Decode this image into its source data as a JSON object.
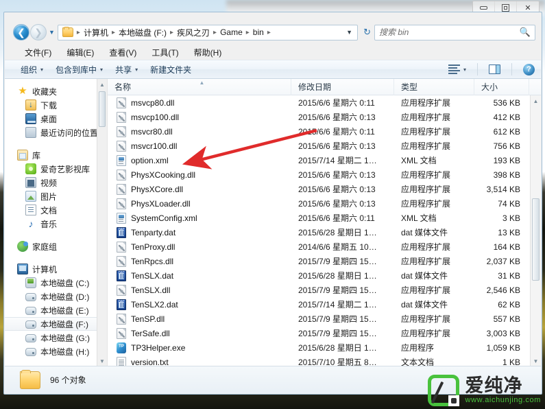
{
  "window": {
    "controls": {
      "minimize": "—",
      "restore": "❐",
      "close": "✕"
    }
  },
  "addressbar": {
    "back_label": "◀",
    "forward_label": "▶",
    "history_caret": "▼",
    "folder_icon": "folder-icon",
    "crumbs": [
      "计算机",
      "本地磁盘 (F:)",
      "疾风之刃",
      "Game",
      "bin"
    ],
    "separator": "▸",
    "dropdown_caret": "▼",
    "refresh_label": "↻"
  },
  "search": {
    "placeholder": "搜索 bin",
    "value": "",
    "icon": "search-icon"
  },
  "menubar": {
    "items": [
      "文件(F)",
      "编辑(E)",
      "查看(V)",
      "工具(T)",
      "帮助(H)"
    ]
  },
  "toolbar": {
    "organize": "组织",
    "include_in_library": "包含到库中",
    "share": "共享",
    "new_folder": "新建文件夹",
    "caret": "▾",
    "help_glyph": "?"
  },
  "navpane": {
    "groups": [
      {
        "header": {
          "label": "收藏夹",
          "icon": "star-icon"
        },
        "items": [
          {
            "label": "下载",
            "icon": "downloads-icon"
          },
          {
            "label": "桌面",
            "icon": "desktop-icon"
          },
          {
            "label": "最近访问的位置",
            "icon": "recent-places-icon"
          }
        ]
      },
      {
        "header": {
          "label": "库",
          "icon": "library-icon"
        },
        "items": [
          {
            "label": "爱奇艺影视库",
            "icon": "iqiyi-icon"
          },
          {
            "label": "视频",
            "icon": "videos-icon"
          },
          {
            "label": "图片",
            "icon": "pictures-icon"
          },
          {
            "label": "文档",
            "icon": "documents-icon"
          },
          {
            "label": "音乐",
            "icon": "music-icon"
          }
        ]
      },
      {
        "header": {
          "label": "家庭组",
          "icon": "homegroup-icon"
        },
        "items": []
      },
      {
        "header": {
          "label": "计算机",
          "icon": "computer-icon"
        },
        "items": [
          {
            "label": "本地磁盘 (C:)",
            "icon": "system-drive-icon",
            "selected": false
          },
          {
            "label": "本地磁盘 (D:)",
            "icon": "drive-icon",
            "selected": false
          },
          {
            "label": "本地磁盘 (E:)",
            "icon": "drive-icon",
            "selected": false
          },
          {
            "label": "本地磁盘 (F:)",
            "icon": "drive-icon",
            "selected": true
          },
          {
            "label": "本地磁盘 (G:)",
            "icon": "drive-icon",
            "selected": false
          },
          {
            "label": "本地磁盘 (H:)",
            "icon": "drive-icon",
            "selected": false
          }
        ]
      }
    ]
  },
  "filelist": {
    "columns": [
      "名称",
      "修改日期",
      "类型",
      "大小"
    ],
    "sort_indicator": "▲",
    "rows": [
      {
        "name": "msvcp80.dll",
        "icon": "dll-file-icon",
        "date": "2015/6/6 星期六 0:11",
        "type": "应用程序扩展",
        "size": "536 KB"
      },
      {
        "name": "msvcp100.dll",
        "icon": "dll-file-icon",
        "date": "2015/6/6 星期六 0:13",
        "type": "应用程序扩展",
        "size": "412 KB"
      },
      {
        "name": "msvcr80.dll",
        "icon": "dll-file-icon",
        "date": "2015/6/6 星期六 0:11",
        "type": "应用程序扩展",
        "size": "612 KB"
      },
      {
        "name": "msvcr100.dll",
        "icon": "dll-file-icon",
        "date": "2015/6/6 星期六 0:13",
        "type": "应用程序扩展",
        "size": "756 KB"
      },
      {
        "name": "option.xml",
        "icon": "xml-file-icon",
        "date": "2015/7/14 星期二 1…",
        "type": "XML 文档",
        "size": "193 KB"
      },
      {
        "name": "PhysXCooking.dll",
        "icon": "dll-file-icon",
        "date": "2015/6/6 星期六 0:13",
        "type": "应用程序扩展",
        "size": "398 KB"
      },
      {
        "name": "PhysXCore.dll",
        "icon": "dll-file-icon",
        "date": "2015/6/6 星期六 0:13",
        "type": "应用程序扩展",
        "size": "3,514 KB"
      },
      {
        "name": "PhysXLoader.dll",
        "icon": "dll-file-icon",
        "date": "2015/6/6 星期六 0:13",
        "type": "应用程序扩展",
        "size": "74 KB"
      },
      {
        "name": "SystemConfig.xml",
        "icon": "xml-file-icon",
        "date": "2015/6/6 星期六 0:11",
        "type": "XML 文档",
        "size": "3 KB"
      },
      {
        "name": "Tenparty.dat",
        "icon": "dat-file-icon",
        "date": "2015/6/28 星期日 1…",
        "type": "dat 媒体文件",
        "size": "13 KB"
      },
      {
        "name": "TenProxy.dll",
        "icon": "dll-file-icon",
        "date": "2014/6/6 星期五 10…",
        "type": "应用程序扩展",
        "size": "164 KB"
      },
      {
        "name": "TenRpcs.dll",
        "icon": "dll-file-icon",
        "date": "2015/7/9 星期四 15…",
        "type": "应用程序扩展",
        "size": "2,037 KB"
      },
      {
        "name": "TenSLX.dat",
        "icon": "dat-file-icon",
        "date": "2015/6/28 星期日 1…",
        "type": "dat 媒体文件",
        "size": "31 KB"
      },
      {
        "name": "TenSLX.dll",
        "icon": "dll-file-icon",
        "date": "2015/7/9 星期四 15…",
        "type": "应用程序扩展",
        "size": "2,546 KB"
      },
      {
        "name": "TenSLX2.dat",
        "icon": "dat-file-icon",
        "date": "2015/7/14 星期二 1…",
        "type": "dat 媒体文件",
        "size": "62 KB"
      },
      {
        "name": "TenSP.dll",
        "icon": "dll-file-icon",
        "date": "2015/7/9 星期四 15…",
        "type": "应用程序扩展",
        "size": "557 KB"
      },
      {
        "name": "TerSafe.dll",
        "icon": "dll-file-icon",
        "date": "2015/7/9 星期四 15…",
        "type": "应用程序扩展",
        "size": "3,003 KB"
      },
      {
        "name": "TP3Helper.exe",
        "icon": "exe-file-icon",
        "date": "2015/6/28 星期日 1…",
        "type": "应用程序",
        "size": "1,059 KB"
      },
      {
        "name": "version.txt",
        "icon": "txt-file-icon",
        "date": "2015/7/10 星期五 8…",
        "type": "文本文档",
        "size": "1 KB"
      }
    ]
  },
  "statusbar": {
    "text": "96 个对象",
    "folder_icon": "folder-icon"
  },
  "annotation": {
    "arrow_color": "#e02b2b",
    "points_to": "option.xml"
  },
  "watermark": {
    "brand": "爱纯净",
    "url": "www.aichunjing.com",
    "brand_color": "#49c23d"
  }
}
